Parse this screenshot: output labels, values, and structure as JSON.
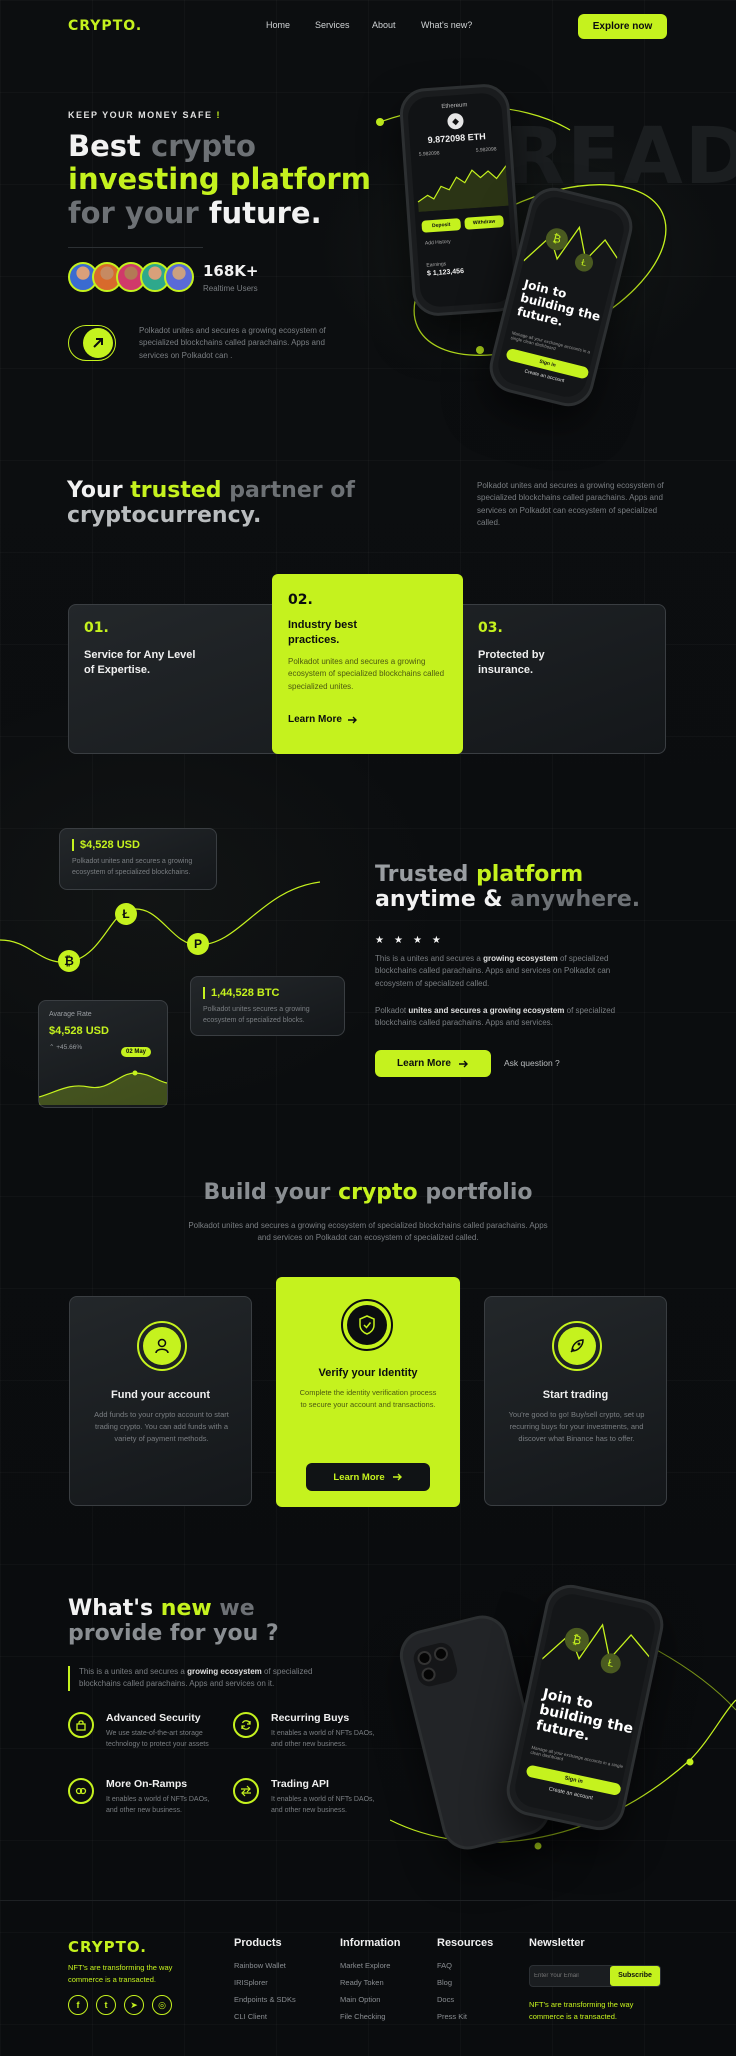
{
  "nav": {
    "logo": "CRYPTO.",
    "links": [
      "Home",
      "Services",
      "About",
      "What's new?"
    ],
    "cta": "Explore now"
  },
  "hero": {
    "eyebrow": "KEEP YOUR MONEY SAFE",
    "title_line1_a": "Best",
    "title_line1_b": "crypto",
    "title_line2": "investing platform",
    "title_line3_a": "for your",
    "title_line3_b": "future.",
    "users_count": "168K+",
    "users_label": "Realtime Users",
    "description": "Polkadot unites and secures a growing ecosystem of specialized blockchains called parachains. Apps and services on Polkadot can .",
    "bg_word": "READ"
  },
  "hero_phone": {
    "coin": "Ethereum",
    "balance": "9.872098 ETH",
    "stat1_value": "5.982098",
    "stat2_value": "5.982098",
    "btn1": "Deposit",
    "btn2": "Withdraw",
    "section": "Add History",
    "earnings_label": "Earnings",
    "earnings_value": "$ 1,123,456",
    "badge": "+12%"
  },
  "hero_phone2": {
    "headline": "Join to building the future.",
    "sub": "Manage all your exchange accounts in a single clean dashboard",
    "btn": "Sign in",
    "link": "Create an account"
  },
  "partner": {
    "title_a": "Your",
    "title_b": "trusted",
    "title_c": "partner of",
    "title_d": "cryptocurrency.",
    "description": "Polkadot unites and secures a growing ecosystem of specialized blockchains called parachains. Apps and services on Polkadot can ecosystem of specialized  called.",
    "cards": [
      {
        "num": "01.",
        "title": "Service for Any Level of Expertise."
      },
      {
        "num": "02.",
        "title": "Industry best practices.",
        "text": "Polkadot unites and secures a growing ecosystem of specialized blockchains called  specialized unites.",
        "link": "Learn More"
      },
      {
        "num": "03.",
        "title": "Protected by insurance."
      }
    ]
  },
  "trusted": {
    "widget1_value": "$4,528 USD",
    "widget1_text": "Polkadot unites and secures a growing ecosystem of specialized blockchains.",
    "widget2_value": "1,44,528 BTC",
    "widget2_text": "Polkadot unites secures a growing ecosystem of specialized blocks.",
    "widget3_label": "Avarage Rate",
    "widget3_value": "$4,528 USD",
    "widget3_change": "+45.66%",
    "widget3_tag": "02 May",
    "title_a": "Trusted",
    "title_b": "platform",
    "title_c": "anytime &",
    "title_d": "anywhere.",
    "p1_a": "This is a unites and secures a ",
    "p1_b": "growing ecosystem",
    "p1_c": " of specialized blockchains called parachains. Apps and services on Polkadot can ecosystem of specialized called.",
    "p2_a": "Polkadot ",
    "p2_b": "unites and secures a growing ecosystem",
    "p2_c": " of specialized blockchains called parachains. Apps and services.",
    "btn": "Learn More",
    "ask": "Ask question ?"
  },
  "portfolio": {
    "title_a": "Build your",
    "title_b": "crypto",
    "title_c": "portfolio",
    "description": "Polkadot unites and secures a growing ecosystem of specialized blockchains called parachains. Apps and services on Polkadot can  ecosystem of specialized  called.",
    "cards": [
      {
        "title": "Fund your account",
        "text": "Add funds to your crypto account to start trading crypto. You can add funds with a variety of payment methods."
      },
      {
        "title": "Verify your Identity",
        "text": "Complete the identity verification process to secure your account and transactions.",
        "btn": "Learn More"
      },
      {
        "title": "Start trading",
        "text": "You're good to go! Buy/sell crypto, set up recurring buys for your investments, and discover what Binance has to offer."
      }
    ]
  },
  "provide": {
    "title_a": "What's",
    "title_b": "new",
    "title_c": "we",
    "title_d": "provide for you ?",
    "intro_a": "This is a unites and secures a ",
    "intro_b": "growing ecosystem",
    "intro_c": " of specialized blockchains called parachains. Apps and services on it.",
    "features": [
      {
        "title": "Advanced Security",
        "text": "We use state-of-the-art storage technology to protect your assets"
      },
      {
        "title": "Recurring Buys",
        "text": "It  enables a world of NFTs DAOs, and other new business."
      },
      {
        "title": "More On-Ramps",
        "text": "It  enables a world of NFTs DAOs, and other new business."
      },
      {
        "title": "Trading API",
        "text": "It  enables a world of NFTs DAOs, and other new business."
      }
    ],
    "phone_headline": "Join to building the future.",
    "phone_sub": "Manage all your exchange accounts in a single clean dashboard",
    "phone_btn": "Sign in",
    "phone_link": "Create an account"
  },
  "footer": {
    "logo": "CRYPTO.",
    "tagline": "NFT's are transforming the way commerce is a transacted.",
    "cols": [
      {
        "title": "Products",
        "links": [
          "Rainbow Wallet",
          "IRISplorer",
          "Endpoints & SDKs",
          "CLI Client"
        ]
      },
      {
        "title": "Information",
        "links": [
          "Market Explore",
          "Ready Token",
          "Main Option",
          "File Checking"
        ]
      },
      {
        "title": "Resources",
        "links": [
          "FAQ",
          "Blog",
          "Docs",
          "Press Kit"
        ]
      }
    ],
    "newsletter_title": "Newsletter",
    "email_placeholder": "Enter Your Email",
    "subscribe": "Subscribe",
    "newsletter_text": "NFT's are transforming the way commerce is a transacted."
  },
  "colors": {
    "accent": "#c5f21e",
    "background": "#0b0d0f"
  }
}
